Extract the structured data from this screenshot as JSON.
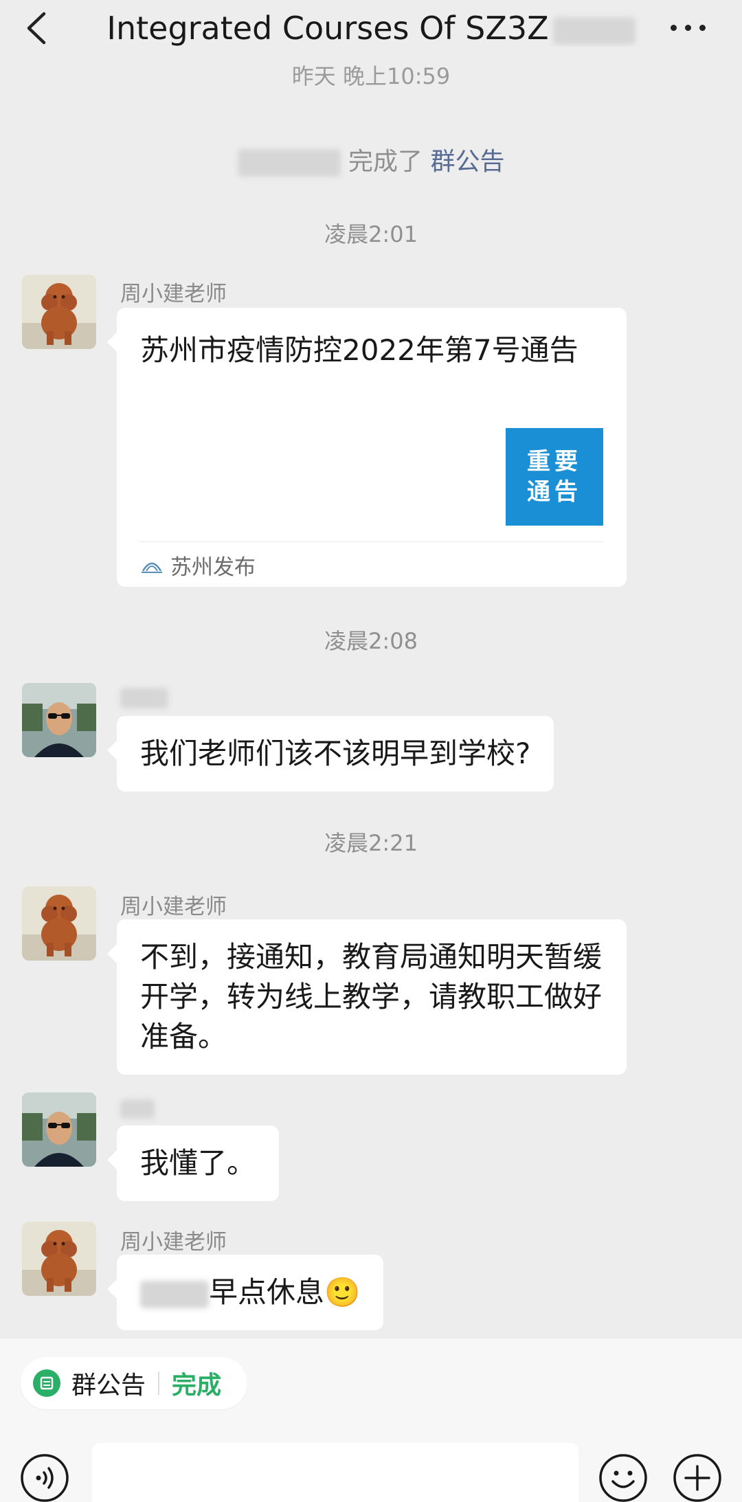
{
  "header": {
    "title": "Integrated Courses Of SZ3Z",
    "back_icon": "chevron-left-icon",
    "more_icon": "more-dots-icon"
  },
  "timeline": {
    "ts_top": "昨天 晚上10:59",
    "system_text": "完成了",
    "system_link": "群公告",
    "ts1": "凌晨2:01",
    "ts2": "凌晨2:08",
    "ts3": "凌晨2:21"
  },
  "messages": {
    "m1": {
      "sender": "周小建老师",
      "card_title": "苏州市疫情防控2022年第7号通告",
      "card_thumb_text": "重要通告",
      "card_source": "苏州发布"
    },
    "m2": {
      "text": "我们老师们该不该明早到学校?"
    },
    "m3": {
      "sender": "周小建老师",
      "text": "不到，接通知，教育局通知明天暂缓开学，转为线上教学，请教职工做好准备。"
    },
    "m4": {
      "text": "我懂了。"
    },
    "m5": {
      "sender": "周小建老师",
      "text": "早点休息🙂"
    }
  },
  "bottom": {
    "notice_label": "群公告",
    "notice_done": "完成"
  },
  "colors": {
    "background": "#ededed",
    "bubble": "#ffffff",
    "link": "#576b95",
    "accent_green": "#2bae66",
    "card_thumb": "#1a8fd6"
  }
}
